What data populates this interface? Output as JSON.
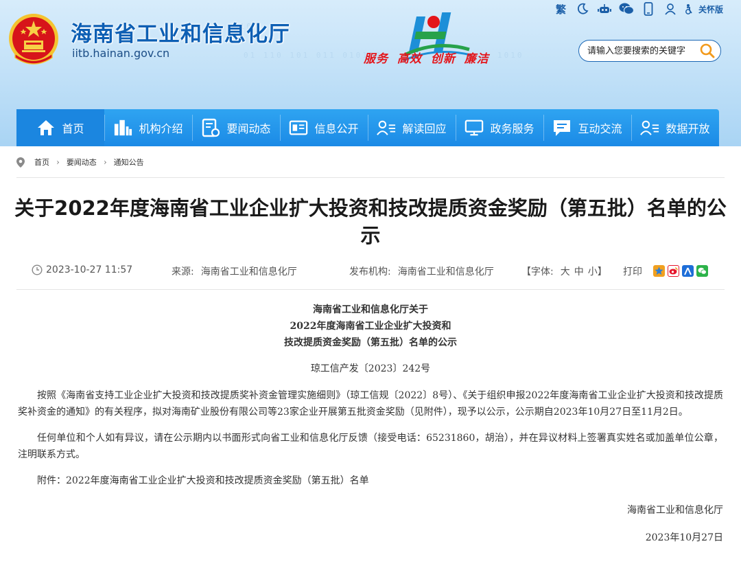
{
  "header": {
    "site_name": "海南省工业和信息化厅",
    "domain": "iitb.hainan.gov.cn",
    "slogan": [
      "服务",
      "高效",
      "创新",
      "廉洁"
    ],
    "binary_text": [
      "01 110 101 011 010110",
      "010",
      "1010"
    ],
    "topbar": {
      "traditional_label": "繁",
      "care_label": "关怀版"
    },
    "search": {
      "placeholder": "请输入您要搜索的关键字"
    }
  },
  "nav": {
    "items": [
      {
        "label": "首页",
        "icon": "home-icon"
      },
      {
        "label": "机构介绍",
        "icon": "building-icon"
      },
      {
        "label": "要闻动态",
        "icon": "news-icon"
      },
      {
        "label": "信息公开",
        "icon": "info-icon"
      },
      {
        "label": "解读回应",
        "icon": "person-list-icon"
      },
      {
        "label": "政务服务",
        "icon": "monitor-icon"
      },
      {
        "label": "互动交流",
        "icon": "chat-icon"
      },
      {
        "label": "数据开放",
        "icon": "data-icon"
      }
    ]
  },
  "breadcrumb": [
    "首页",
    "要闻动态",
    "通知公告"
  ],
  "article": {
    "title": "关于2022年度海南省工业企业扩大投资和技改提质资金奖励（第五批）名单的公示",
    "meta": {
      "datetime": "2023-10-27 11:57",
      "source_label": "来源:",
      "source": "海南省工业和信息化厅",
      "publisher_label": "发布机构:",
      "publisher": "海南省工业和信息化厅",
      "font_label": "【字体:",
      "font_sizes": [
        "大",
        "中",
        "小"
      ],
      "font_close": "】",
      "print_label": "打印"
    },
    "doc_heading": [
      "海南省工业和信息化厅关于",
      "2022年度海南省工业企业扩大投资和",
      "技改提质资金奖励（第五批）名单的公示"
    ],
    "doc_number": "琼工信产发〔2023〕242号",
    "paragraphs": [
      "按照《海南省支持工业企业扩大投资和技改提质奖补资金管理实施细则》（琼工信规〔2022〕8号）、《关于组织申报2022年度海南省工业企业扩大投资和技改提质奖补资金的通知》的有关程序，拟对海南矿业股份有限公司等23家企业开展第五批资金奖励（见附件），现予以公示，公示期自2023年10月27日至11月2日。",
      "任何单位和个人如有异议，请在公示期内以书面形式向省工业和信息化厅反馈（接受电话：65231860，胡治），并在异议材料上签署真实姓名或加盖单位公章，注明联系方式。",
      "附件：2022年度海南省工业企业扩大投资和技改提质资金奖励（第五批）名单"
    ],
    "signer": "海南省工业和信息化厅",
    "sign_date": "2023年10月27日"
  },
  "colors": {
    "brand_blue": "#0d5fb4",
    "nav_blue": "#1b8ae6",
    "slogan_red": "#e4161b",
    "slogan_green": "#1d8b3a"
  }
}
